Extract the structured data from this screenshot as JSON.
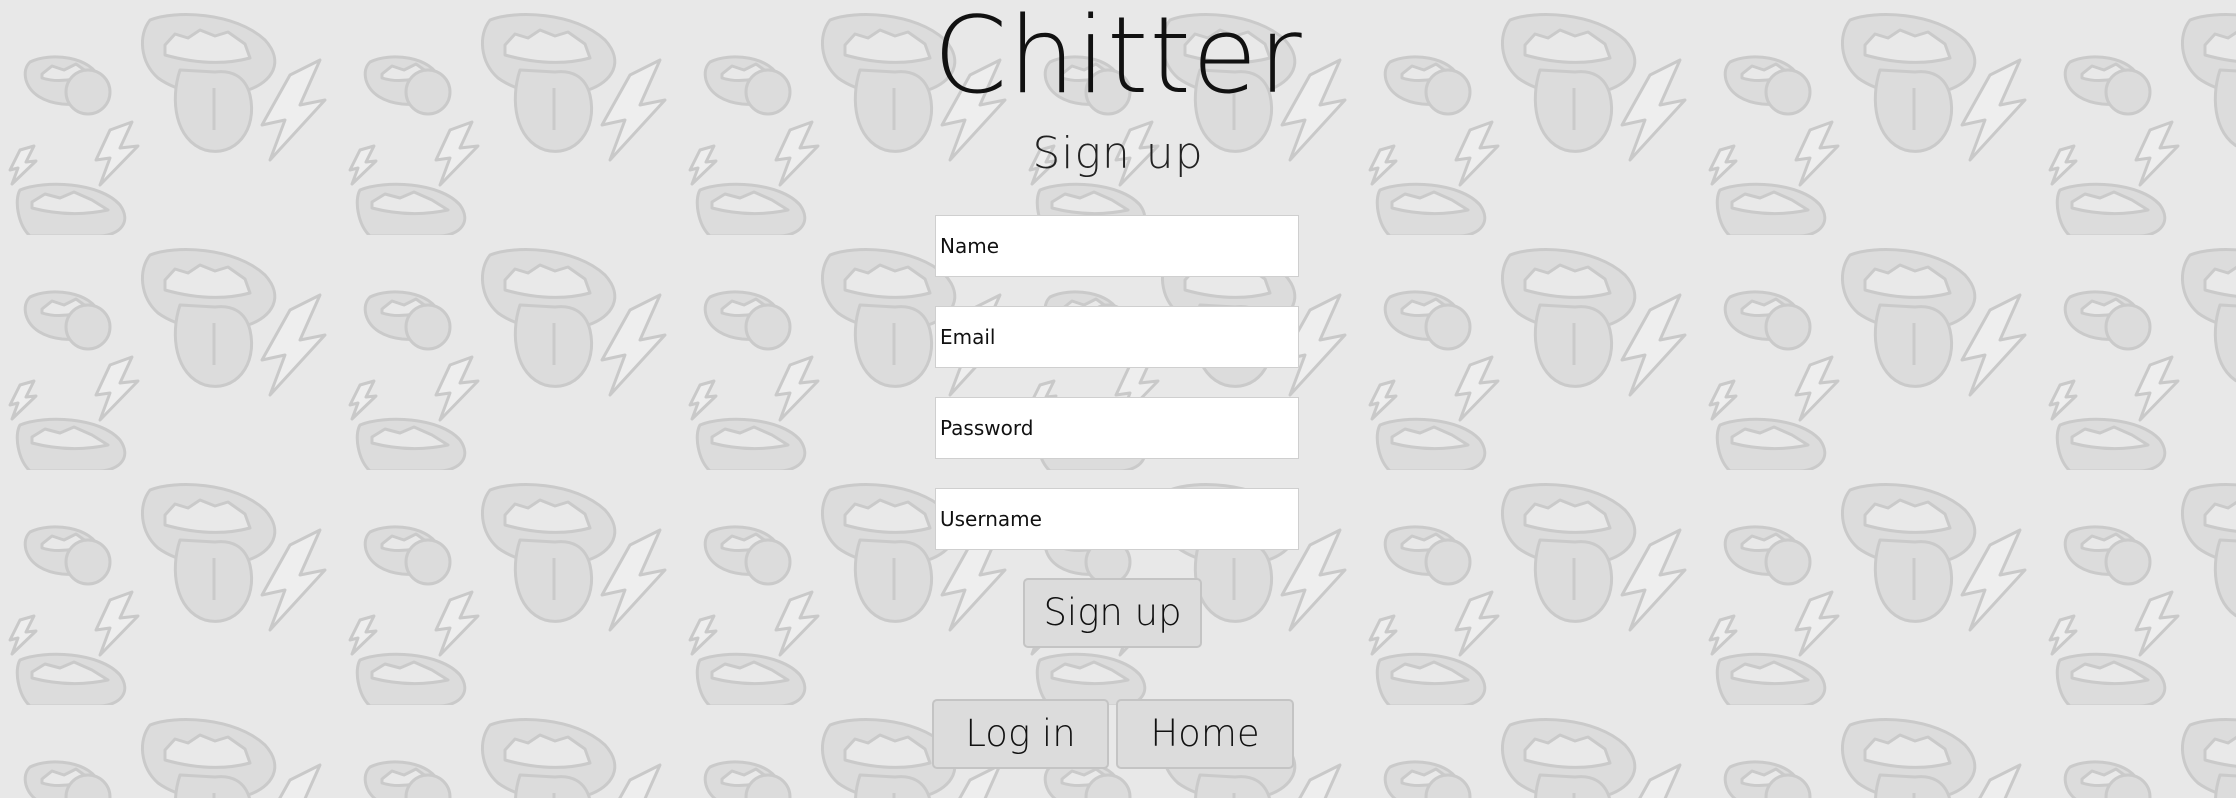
{
  "app": {
    "title": "Chitter",
    "subtitle": "Sign up"
  },
  "form": {
    "name_placeholder": "Name",
    "email_placeholder": "Email",
    "password_placeholder": "Password",
    "username_placeholder": "Username",
    "submit_label": "Sign up"
  },
  "nav": {
    "login_label": "Log in",
    "home_label": "Home"
  },
  "theme": {
    "background": "#e8e8e8",
    "pattern_fill": "#dcdcdc",
    "pattern_stroke": "#c8c8c8",
    "button_bg": "#dcdcdc"
  }
}
